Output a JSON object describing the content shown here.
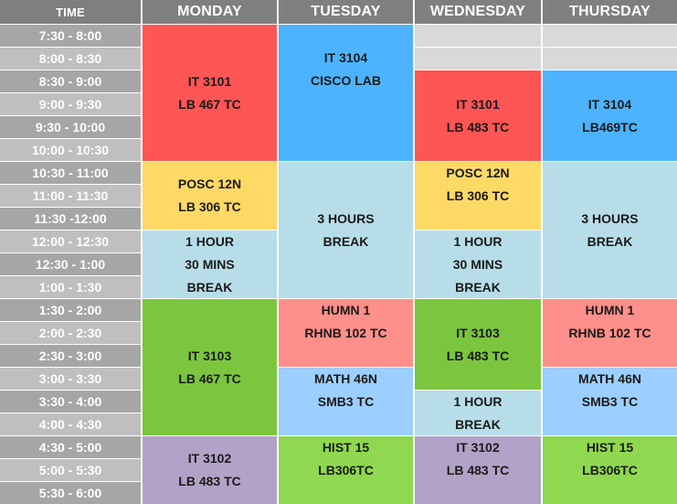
{
  "header": {
    "time": "TIME",
    "days": [
      "MONDAY",
      "TUESDAY",
      "WEDNESDAY",
      "THURSDAY"
    ]
  },
  "times": [
    "7:30 - 8:00",
    "8:00 - 8:30",
    "8:30 - 9:00",
    "9:00 - 9:30",
    "9:30 - 10:00",
    "10:00 - 10:30",
    "10:30 - 11:00",
    "11:00 - 11:30",
    "11:30 -12:00",
    "12:00 - 12:30",
    "12:30 - 1:00",
    "1:00 - 1:30",
    "1:30 - 2:00",
    "2:00 - 2:30",
    "2:30 - 3:00",
    "3:00 - 3:30",
    "3:30 - 4:00",
    "4:00 - 4:30",
    "4:30 - 5:00",
    "5:00 - 5:30",
    "5:30 - 6:00"
  ],
  "colors": {
    "red": "#ff5555",
    "blue": "#4db3ff",
    "yellow": "#ffd966",
    "lightblue": "#b7dde8",
    "green": "#7cc63f",
    "salmon": "#ff8f8a",
    "skyblue": "#9ccfff",
    "lightgreen": "#8fd84f",
    "lavender": "#b3a2c7",
    "gray": "#d9d9d9"
  },
  "blocks": {
    "mon_it3101": {
      "line1": "IT 3101",
      "line2": "LB 467 TC"
    },
    "mon_posc": {
      "line1": "POSC 12N",
      "line2": "LB 306 TC"
    },
    "mon_break": {
      "line1": "1 HOUR",
      "line2": "30 MINS",
      "line3": "BREAK"
    },
    "mon_it3103": {
      "line1": "IT 3103",
      "line2": "LB 467 TC"
    },
    "mon_it3102": {
      "line1": "IT 3102",
      "line2": "LB 483 TC"
    },
    "tue_it3104": {
      "line1": "IT 3104",
      "line2": "CISCO LAB"
    },
    "tue_break": {
      "line1": "3 HOURS",
      "line2": "BREAK"
    },
    "tue_humn": {
      "line1": "HUMN 1",
      "line2": "RHNB 102 TC"
    },
    "tue_math": {
      "line1": "MATH 46N",
      "line2": "SMB3 TC"
    },
    "tue_hist": {
      "line1": "HIST 15",
      "line2": "LB306TC"
    },
    "wed_it3101": {
      "line1": "IT 3101",
      "line2": "LB 483 TC"
    },
    "wed_posc": {
      "line1": "POSC 12N",
      "line2": "LB 306 TC"
    },
    "wed_break": {
      "line1": "1 HOUR",
      "line2": "30 MINS",
      "line3": "BREAK"
    },
    "wed_it3103": {
      "line1": "IT 3103",
      "line2": "LB 483 TC"
    },
    "wed_break2": {
      "line1": "1 HOUR",
      "line2": "BREAK"
    },
    "wed_it3102": {
      "line1": "IT 3102",
      "line2": "LB 483 TC"
    },
    "thu_it3104": {
      "line1": "IT 3104",
      "line2": "LB469TC"
    },
    "thu_break": {
      "line1": "3 HOURS",
      "line2": "BREAK"
    },
    "thu_humn": {
      "line1": "HUMN 1",
      "line2": "RHNB 102 TC"
    },
    "thu_math": {
      "line1": "MATH 46N",
      "line2": "SMB3 TC"
    },
    "thu_hist": {
      "line1": "HIST 15",
      "line2": "LB306TC"
    }
  }
}
